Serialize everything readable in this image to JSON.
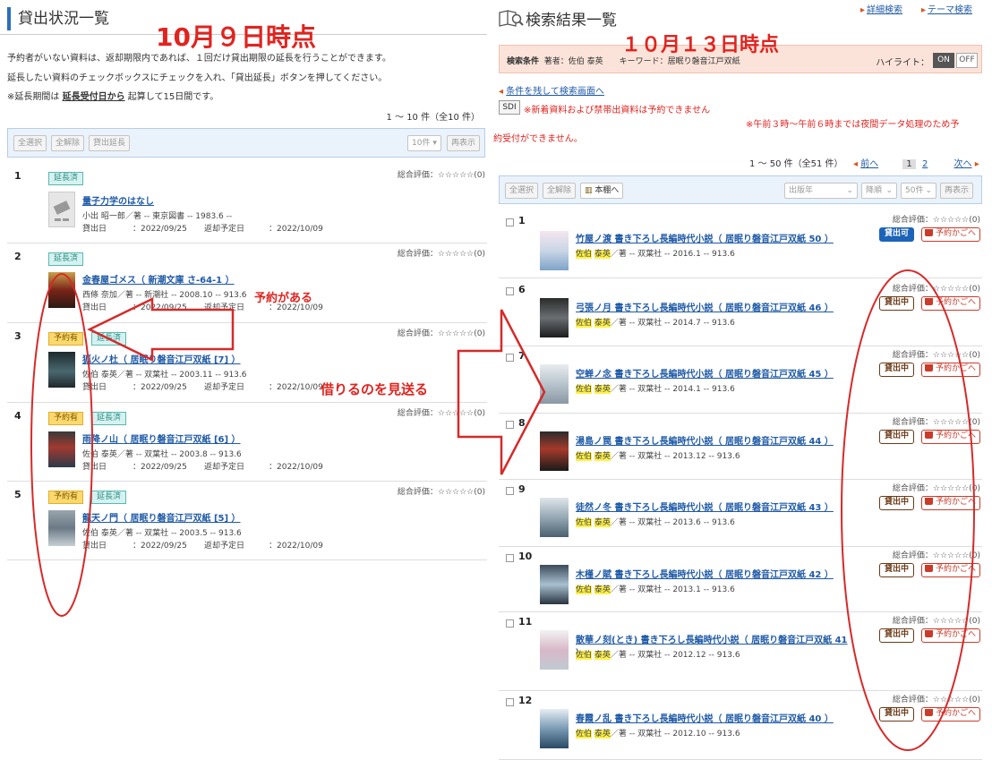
{
  "left": {
    "title": "貸出状況一覧",
    "notes": [
      "予約者がいない資料は、返却期限内であれば、１回だけ貸出期限の延長を行うことができます。",
      "延長したい資料のチェックボックスにチェックを入れ、「貸出延長」ボタンを押してください。"
    ],
    "note3_pre": "※延長期間は",
    "note3_link": "延長受付日から",
    "note3_post": "起算して15日間です。",
    "range": "1 ～ 10 件（全10 件）",
    "toolbar": {
      "select_all": "全選択",
      "deselect_all": "全解除",
      "extend": "貸出延長",
      "per_page": "10件 ▾",
      "redisplay": "再表示"
    },
    "rating_label": "総合評価：☆☆☆☆☆(0)",
    "items": [
      {
        "num": "1",
        "badges": [
          "延長済"
        ],
        "title": "量子力学のはなし",
        "meta": "小出 昭一郎／著 -- 東京図書 -- 1983.6 --",
        "loan_label": "貸出日",
        "loan_date": "：2022/09/25",
        "due_label": "返却予定日",
        "due_date": "：2022/10/09"
      },
      {
        "num": "2",
        "badges": [
          "延長済"
        ],
        "title": "金春屋ゴメス（ 新潮文庫 さ-64-1 ）",
        "meta": "西條 奈加／著 -- 新潮社 -- 2008.10 -- 913.6",
        "loan_label": "貸出日",
        "loan_date": "：2022/09/25",
        "due_label": "返却予定日",
        "due_date": "：2022/10/09"
      },
      {
        "num": "3",
        "badges": [
          "予約有",
          "延長済"
        ],
        "title": "狐火ノ杜（ 居眠り磐音江戸双紙 [7] ）",
        "meta": "佐伯 泰英／著 -- 双葉社 -- 2003.11 -- 913.6",
        "loan_label": "貸出日",
        "loan_date": "：2022/09/25",
        "due_label": "返却予定日",
        "due_date": "：2022/10/09"
      },
      {
        "num": "4",
        "badges": [
          "予約有",
          "延長済"
        ],
        "title": "雨降ノ山（ 居眠り磐音江戸双紙 [6] ）",
        "meta": "佐伯 泰英／著 -- 双葉社 -- 2003.8 -- 913.6",
        "loan_label": "貸出日",
        "loan_date": "：2022/09/25",
        "due_label": "返却予定日",
        "due_date": "：2022/10/09"
      },
      {
        "num": "5",
        "badges": [
          "予約有",
          "延長済"
        ],
        "title": "龍天ノ門（ 居眠り磐音江戸双紙 [5] ）",
        "meta": "佐伯 泰英／著 -- 双葉社 -- 2003.5 -- 913.6",
        "loan_label": "貸出日",
        "loan_date": "：2022/09/25",
        "due_label": "返却予定日",
        "due_date": "：2022/10/09"
      }
    ]
  },
  "right": {
    "title": "検索結果一覧",
    "detail_search": "詳細検索",
    "theme_search": "テーマ検索",
    "cond_label": "検索条件",
    "cond_text": "著者：佐伯 泰英　　キーワード：居眠り磐音江戸双紙",
    "highlight_label": "ハイライト：",
    "on": "ON",
    "off": "OFF",
    "back_link": "条件を残して検索画面へ",
    "sdi": "SDI",
    "warn1": "※新着資料および禁帯出資料は予約できません",
    "warn2": "※午前３時～午前６時までは夜間データ処理のため予",
    "warn3": "約受付ができません。",
    "range": "1 ～ 50 件（全51 件）",
    "prev": "前へ",
    "pages": [
      "1",
      "2"
    ],
    "next": "次へ",
    "toolbar": {
      "select_all": "全選択",
      "deselect_all": "全解除",
      "shelf": "本棚へ",
      "sort_key": "出版年",
      "sort_order": "降順",
      "per_page": "50件",
      "redisplay": "再表示"
    },
    "rating_label": "総合評価：☆☆☆☆☆(0)",
    "cart_label": "予約かごへ",
    "author_first": "佐伯",
    "author_last": "泰英",
    "items": [
      {
        "num": "1",
        "status": "貸出可",
        "title": "竹屋ノ渡 書き下ろし長編時代小説（ 居眠り磐音江戸双紙 50 ）",
        "meta": "／著 -- 双葉社 -- 2016.1 -- 913.6"
      },
      {
        "num": "6",
        "status": "貸出中",
        "title": "弓張ノ月 書き下ろし長編時代小説（ 居眠り磐音江戸双紙 46 ）",
        "meta": "／著 -- 双葉社 -- 2014.7 -- 913.6"
      },
      {
        "num": "7",
        "status": "貸出中",
        "title": "空蝉ノ念 書き下ろし長編時代小説（ 居眠り磐音江戸双紙 45 ）",
        "meta": "／著 -- 双葉社 -- 2014.1 -- 913.6"
      },
      {
        "num": "8",
        "status": "貸出中",
        "title": "湯島ノ罠 書き下ろし長編時代小説（ 居眠り磐音江戸双紙 44 ）",
        "meta": "／著 -- 双葉社 -- 2013.12 -- 913.6"
      },
      {
        "num": "9",
        "status": "貸出中",
        "title": "徒然ノ冬 書き下ろし長編時代小説（ 居眠り磐音江戸双紙 43 ）",
        "meta": "／著 -- 双葉社 -- 2013.6 -- 913.6"
      },
      {
        "num": "10",
        "status": "貸出中",
        "title": "木槿ノ賦 書き下ろし長編時代小説（ 居眠り磐音江戸双紙 42 ）",
        "meta": "／著 -- 双葉社 -- 2013.1 -- 913.6"
      },
      {
        "num": "11",
        "status": "貸出中",
        "title": "散華ノ刻(とき) 書き下ろし長編時代小説（ 居眠り磐音江戸双紙 41 ）",
        "meta": "／著 -- 双葉社 -- 2012.12 -- 913.6"
      },
      {
        "num": "12",
        "status": "貸出中",
        "title": "春霞ノ乱 書き下ろし長編時代小説（ 居眠り磐音江戸双紙 40 ）",
        "meta": "／著 -- 双葉社 -- 2012.10 -- 913.6"
      }
    ]
  },
  "annotations": {
    "date_left": "10月９日時点",
    "date_right": "１０月１３日時点",
    "reserved": "予約がある",
    "skip": "借りるのを見送る"
  },
  "colors": {
    "accent_blue": "#2a6ebb",
    "link_blue": "#1f5aa6",
    "annotation_red": "#e0241f",
    "highlight_yellow": "#fff24a",
    "available_blue": "#1d63b8"
  }
}
